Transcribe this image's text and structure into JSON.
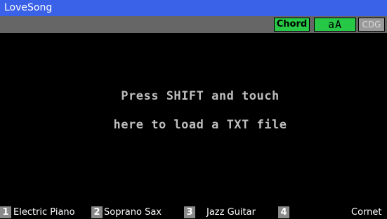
{
  "window": {
    "title": "LoveSong"
  },
  "toolbar": {
    "chord_label": "Chord",
    "font_toggle_label": "aA",
    "cdg_label": "CDG"
  },
  "lyrics": {
    "line1": "Press SHIFT and touch",
    "line2": "here to load a TXT file"
  },
  "tracks": [
    {
      "number": "1",
      "name": "Electric Piano"
    },
    {
      "number": "2",
      "name": "Soprano Sax"
    },
    {
      "number": "3",
      "name": "Jazz Guitar"
    },
    {
      "number": "4",
      "name": "Cornet"
    }
  ],
  "colors": {
    "titlebar": "#3a62e8",
    "toolbar": "#666666",
    "active_button": "#26c845",
    "disabled_button": "#9a9a9a",
    "text_muted": "#bdbdbd",
    "track_number": "#8a8a8a"
  }
}
